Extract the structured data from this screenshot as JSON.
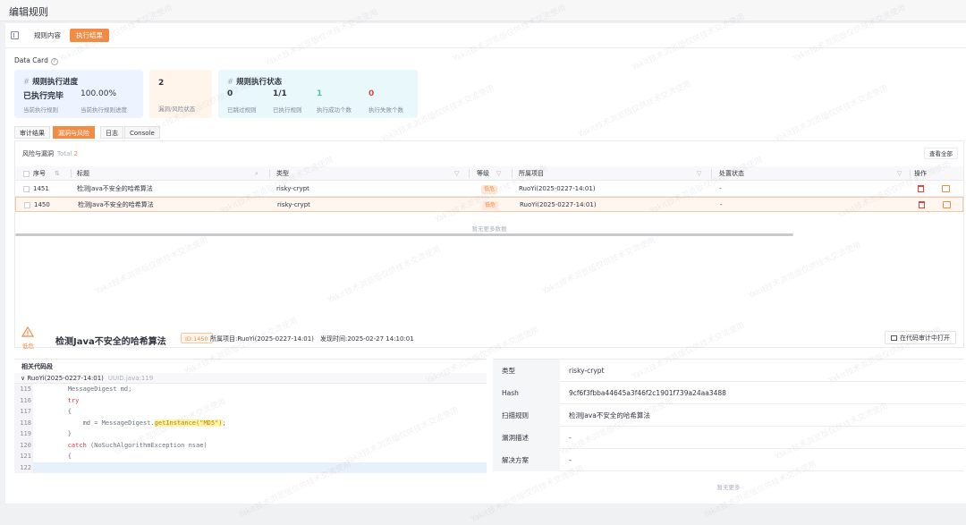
{
  "page_title": "编辑规则",
  "top_tabs": [
    {
      "label": "规则内容"
    },
    {
      "label": "执行结果"
    }
  ],
  "data_card": {
    "label": "Data Card",
    "progress": {
      "title": "规则执行进度",
      "status_value": "已执行完毕",
      "status_label": "当前执行规则",
      "percent_value": "100.00%",
      "percent_label": "当前执行规则进度"
    },
    "vuln": {
      "value": "2",
      "label": "漏洞/风险状态"
    },
    "exec": {
      "title": "规则执行状态",
      "items": [
        {
          "value": "0",
          "label": "已跳过规则",
          "color": "#31343f"
        },
        {
          "value": "1/1",
          "label": "已执行规则",
          "color": "#31343f"
        },
        {
          "value": "1",
          "label": "执行成功个数",
          "color": "#56c2a0"
        },
        {
          "value": "0",
          "label": "执行失败个数",
          "color": "#e0443e"
        }
      ]
    }
  },
  "sub_tabs": [
    {
      "label": "审计结果"
    },
    {
      "label": "漏洞与风险"
    },
    {
      "label": "日志"
    },
    {
      "label": "Console"
    }
  ],
  "risk": {
    "title": "风险与漏洞",
    "total_label": "Total",
    "total_value": "2",
    "view_all": "查看全部",
    "columns": [
      "序号",
      "标题",
      "类型",
      "等级",
      "所属项目",
      "处置状态",
      "操作"
    ],
    "rows": [
      {
        "id": "1451",
        "title": "检测Java不安全的哈希算法",
        "type": "risky-crypt",
        "level": "低危",
        "project": "RuoYi(2025-0227-14:01)",
        "status": "-"
      },
      {
        "id": "1450",
        "title": "检测Java不安全的哈希算法",
        "type": "risky-crypt",
        "level": "低危",
        "project": "RuoYi(2025-0227-14:01)",
        "status": "-"
      }
    ],
    "no_more": "暂无更多数据"
  },
  "detail": {
    "level": "低危",
    "title": "检测Java不安全的哈希算法",
    "id_badge": "ID:1450",
    "project": "所属项目:RuoYi(2025-0227-14:01)",
    "found_time": "发现时间:2025-02-27 14:10:01",
    "open_button": "在代码审计中打开",
    "code_header": "相关代码段",
    "code_file": "RuoYi(2025-0227-14:01)",
    "code_uuid": "UUID.java:119",
    "code_lines": [
      {
        "n": "115",
        "text": "        MessageDigest md;"
      },
      {
        "n": "116",
        "text": "        try"
      },
      {
        "n": "117",
        "text": "        {"
      },
      {
        "n": "118",
        "text": "            md = MessageDigest.getInstance(\"MD5\");"
      },
      {
        "n": "119",
        "text": "        }"
      },
      {
        "n": "120",
        "text": "        catch (NoSuchAlgorithmException nsae)"
      },
      {
        "n": "121",
        "text": "        {"
      },
      {
        "n": "122",
        "text": ""
      }
    ],
    "info": [
      {
        "key": "类型",
        "value": "risky-crypt"
      },
      {
        "key": "Hash",
        "value": "9cf6f3fbba44645a3f46f2c1901f739a24aa3488"
      },
      {
        "key": "扫描规则",
        "value": "检测Java不安全的哈希算法"
      },
      {
        "key": "漏洞描述",
        "value": "-"
      },
      {
        "key": "解决方案",
        "value": "-"
      }
    ],
    "info_no_more": "暂无更多"
  },
  "watermark": "Yakit技术浏览版仅供技术交流使用",
  "colors": {
    "accent": "#f28b44",
    "success": "#56c2a0",
    "danger": "#e0443e"
  }
}
